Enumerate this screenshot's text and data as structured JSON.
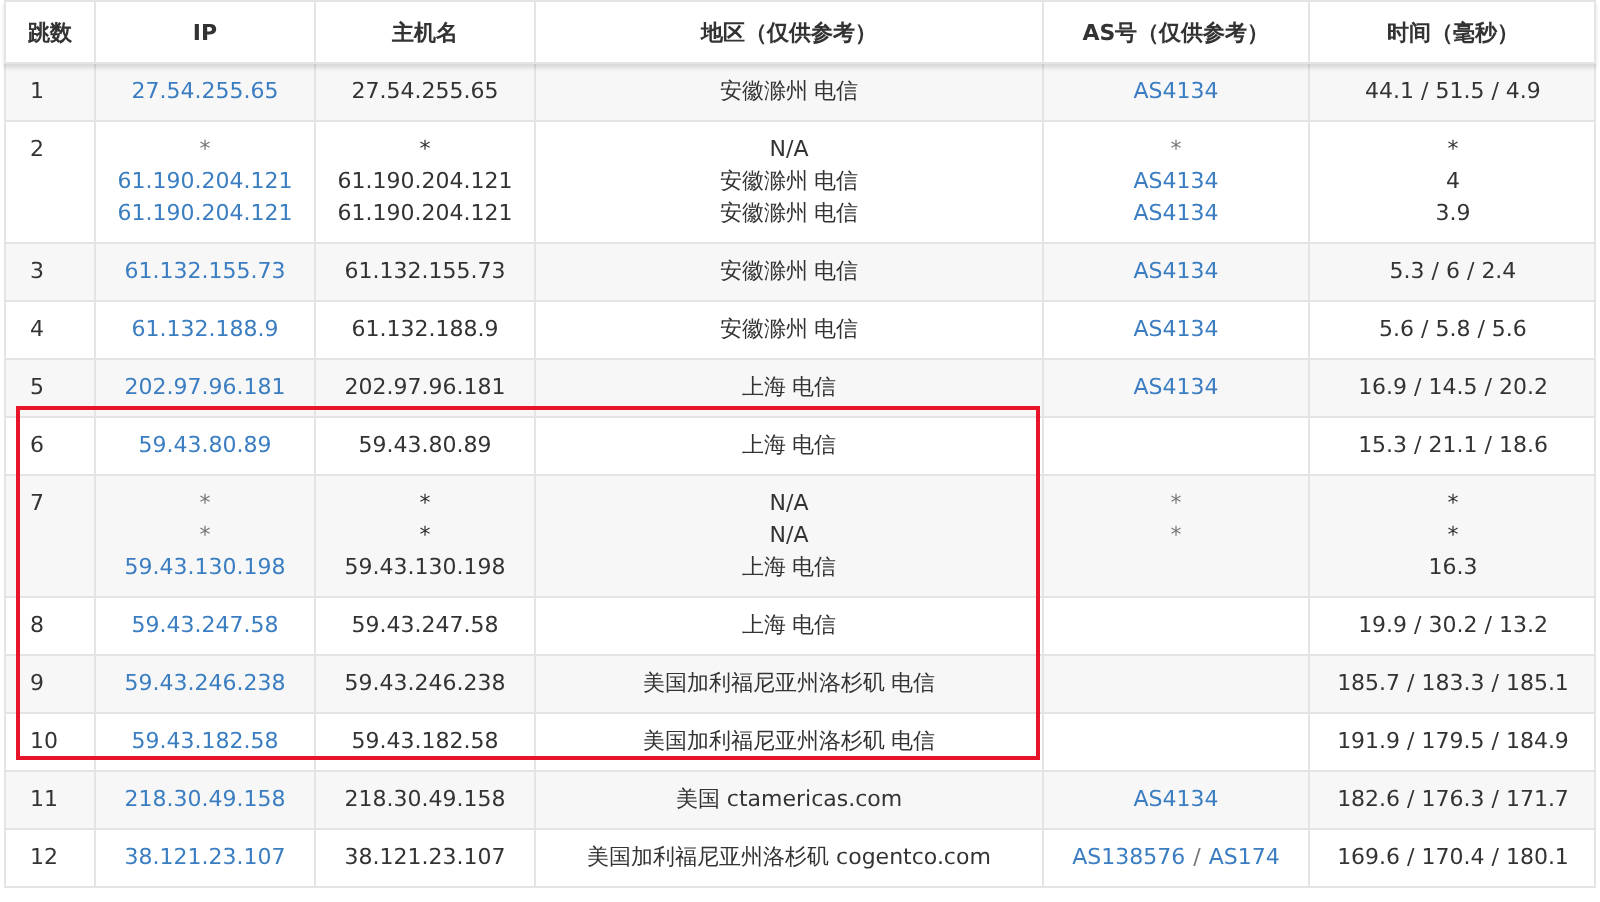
{
  "columns": [
    "跳数",
    "IP",
    "主机名",
    "地区（仅供参考）",
    "AS号（仅供参考）",
    "时间（毫秒）"
  ],
  "row_groups": [
    {
      "framed": false,
      "rows": [
        {
          "hop": "1",
          "ip": [
            {
              "text": "27.54.255.65",
              "link": true
            }
          ],
          "host": [
            "27.54.255.65"
          ],
          "region": [
            "安徽滁州 电信"
          ],
          "as": [
            [
              {
                "text": "AS4134",
                "link": true
              }
            ]
          ],
          "time": [
            "44.1 / 51.5 / 4.9"
          ]
        },
        {
          "hop": "2",
          "ip": [
            {
              "text": "*",
              "link": false
            },
            {
              "text": "61.190.204.121",
              "link": true
            },
            {
              "text": "61.190.204.121",
              "link": true
            }
          ],
          "host": [
            "*",
            "61.190.204.121",
            "61.190.204.121"
          ],
          "region": [
            "N/A",
            "安徽滁州 电信",
            "安徽滁州 电信"
          ],
          "as": [
            [
              {
                "text": "*",
                "link": false
              }
            ],
            [
              {
                "text": "AS4134",
                "link": true
              }
            ],
            [
              {
                "text": "AS4134",
                "link": true
              }
            ]
          ],
          "time": [
            "*",
            "4",
            "3.9"
          ]
        },
        {
          "hop": "3",
          "ip": [
            {
              "text": "61.132.155.73",
              "link": true
            }
          ],
          "host": [
            "61.132.155.73"
          ],
          "region": [
            "安徽滁州 电信"
          ],
          "as": [
            [
              {
                "text": "AS4134",
                "link": true
              }
            ]
          ],
          "time": [
            "5.3 / 6 / 2.4"
          ]
        },
        {
          "hop": "4",
          "ip": [
            {
              "text": "61.132.188.9",
              "link": true
            }
          ],
          "host": [
            "61.132.188.9"
          ],
          "region": [
            "安徽滁州 电信"
          ],
          "as": [
            [
              {
                "text": "AS4134",
                "link": true
              }
            ]
          ],
          "time": [
            "5.6 / 5.8 / 5.6"
          ]
        },
        {
          "hop": "5",
          "ip": [
            {
              "text": "202.97.96.181",
              "link": true
            }
          ],
          "host": [
            "202.97.96.181"
          ],
          "region": [
            "上海 电信"
          ],
          "as": [
            [
              {
                "text": "AS4134",
                "link": true
              }
            ]
          ],
          "time": [
            "16.9 / 14.5 / 20.2"
          ]
        }
      ]
    },
    {
      "framed": true,
      "rows": [
        {
          "hop": "6",
          "ip": [
            {
              "text": "59.43.80.89",
              "link": true
            }
          ],
          "host": [
            "59.43.80.89"
          ],
          "region": [
            "上海 电信"
          ],
          "as": [],
          "time": [
            "15.3 / 21.1 / 18.6"
          ]
        },
        {
          "hop": "7",
          "ip": [
            {
              "text": "*",
              "link": false
            },
            {
              "text": "*",
              "link": false
            },
            {
              "text": "59.43.130.198",
              "link": true
            }
          ],
          "host": [
            "*",
            "*",
            "59.43.130.198"
          ],
          "region": [
            "N/A",
            "N/A",
            "上海 电信"
          ],
          "as": [
            [
              {
                "text": "*",
                "link": false
              }
            ],
            [
              {
                "text": "*",
                "link": false
              }
            ]
          ],
          "time": [
            "*",
            "*",
            "16.3"
          ]
        },
        {
          "hop": "8",
          "ip": [
            {
              "text": "59.43.247.58",
              "link": true
            }
          ],
          "host": [
            "59.43.247.58"
          ],
          "region": [
            "上海 电信"
          ],
          "as": [],
          "time": [
            "19.9 / 30.2 / 13.2"
          ]
        },
        {
          "hop": "9",
          "ip": [
            {
              "text": "59.43.246.238",
              "link": true
            }
          ],
          "host": [
            "59.43.246.238"
          ],
          "region": [
            "美国加利福尼亚州洛杉矶 电信"
          ],
          "as": [],
          "time": [
            "185.7 / 183.3 / 185.1"
          ]
        },
        {
          "hop": "10",
          "ip": [
            {
              "text": "59.43.182.58",
              "link": true
            }
          ],
          "host": [
            "59.43.182.58"
          ],
          "region": [
            "美国加利福尼亚州洛杉矶 电信"
          ],
          "as": [],
          "time": [
            "191.9 / 179.5 / 184.9"
          ]
        }
      ]
    },
    {
      "framed": false,
      "rows": [
        {
          "hop": "11",
          "ip": [
            {
              "text": "218.30.49.158",
              "link": true
            }
          ],
          "host": [
            "218.30.49.158"
          ],
          "region": [
            "美国 ctamericas.com"
          ],
          "as": [
            [
              {
                "text": "AS4134",
                "link": true
              }
            ]
          ],
          "time": [
            "182.6 / 176.3 / 171.7"
          ]
        },
        {
          "hop": "12",
          "ip": [
            {
              "text": "38.121.23.107",
              "link": true
            }
          ],
          "host": [
            "38.121.23.107"
          ],
          "region": [
            "美国加利福尼亚州洛杉矶 cogentco.com"
          ],
          "as": [
            [
              {
                "text": "AS138576",
                "link": true
              },
              {
                "text": "/",
                "link": false
              },
              {
                "text": "AS174",
                "link": true
              }
            ]
          ],
          "time": [
            "169.6 / 170.4 / 180.1"
          ]
        }
      ]
    }
  ]
}
